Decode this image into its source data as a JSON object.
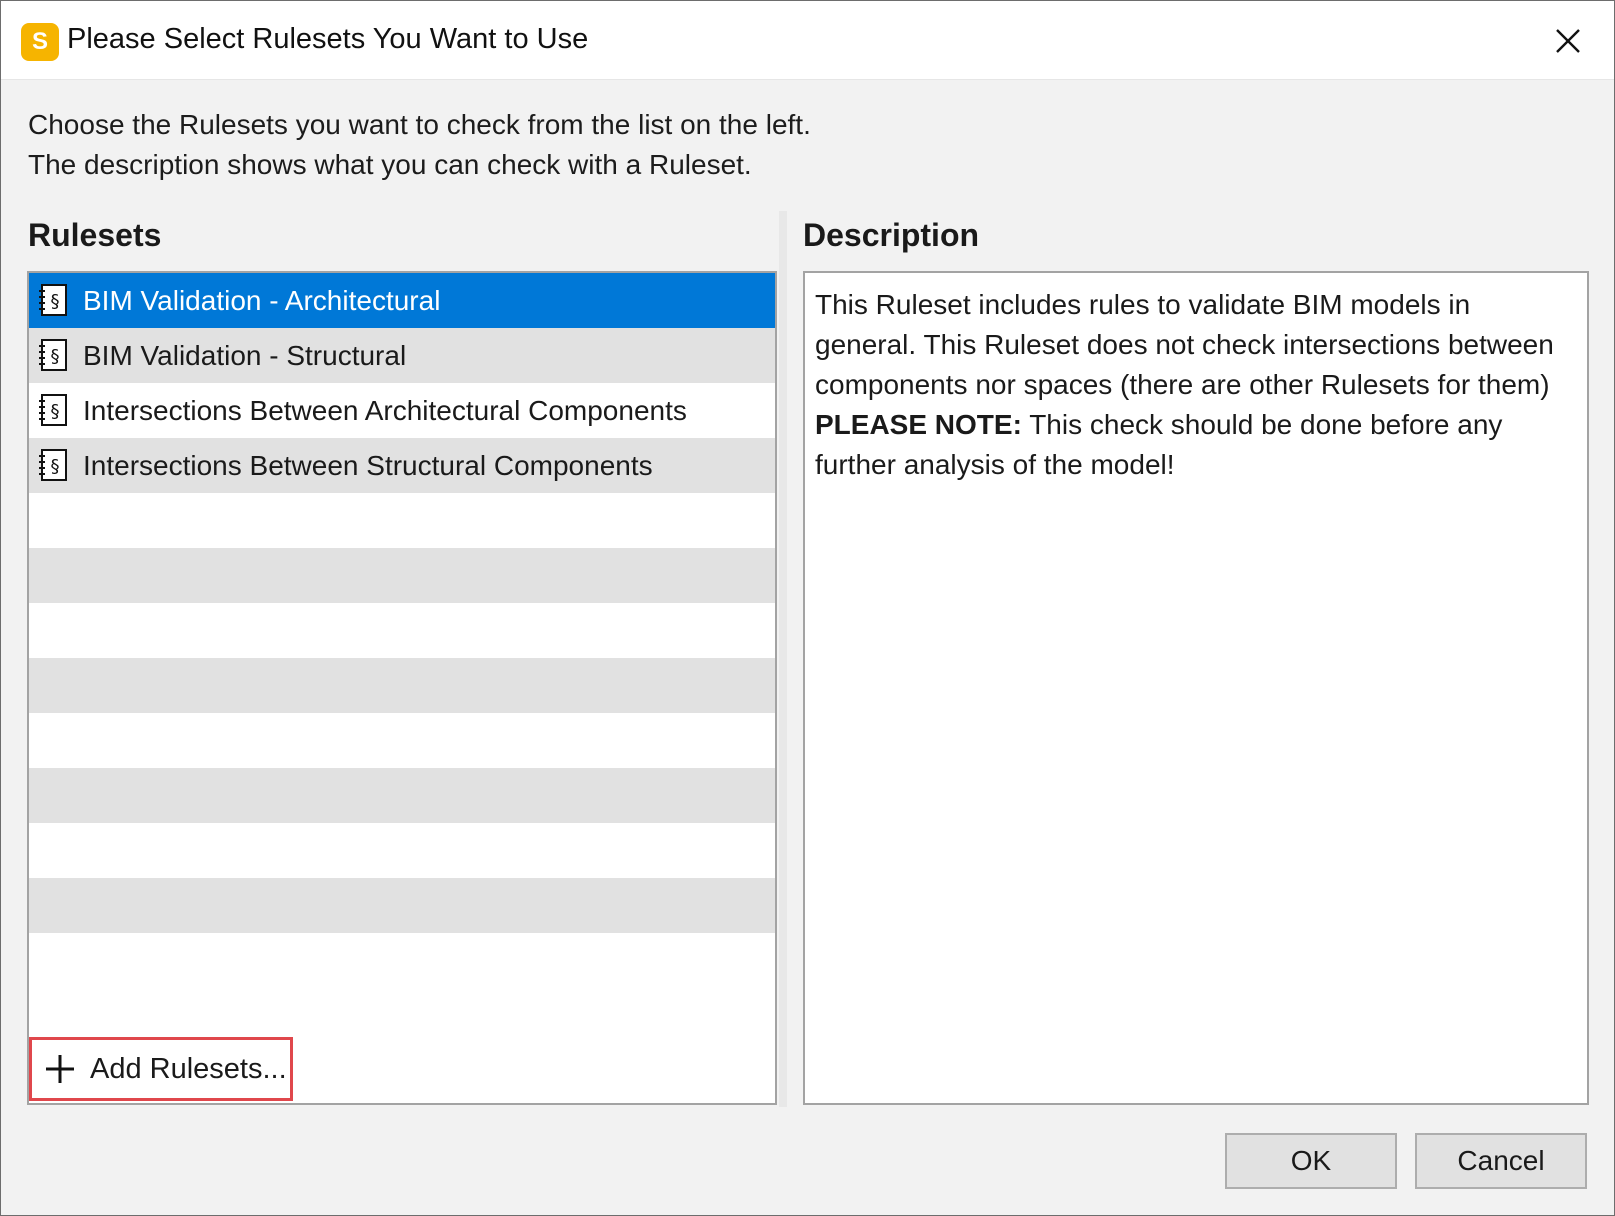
{
  "window": {
    "title": "Please Select Rulesets You Want to Use",
    "app_icon_letter": "S",
    "brand_color": "#f6b400",
    "close_icon": "close-icon"
  },
  "intro": {
    "line1": "Choose the Rulesets you want to check from the list on the left.",
    "line2": "The description shows what you can check with a Ruleset."
  },
  "rulesets": {
    "heading": "Rulesets",
    "selected_color": "#0078d7",
    "items": [
      {
        "label": "BIM Validation - Architectural",
        "icon": "ruleset-icon",
        "selected": true
      },
      {
        "label": "BIM Validation - Structural",
        "icon": "ruleset-icon",
        "selected": false
      },
      {
        "label": "Intersections Between Architectural Components",
        "icon": "ruleset-icon",
        "selected": false
      },
      {
        "label": "Intersections Between Structural Components",
        "icon": "ruleset-icon",
        "selected": false
      }
    ],
    "add_label": "Add Rulesets...",
    "add_icon": "plus-icon"
  },
  "description": {
    "heading": "Description",
    "text": "This Ruleset includes rules to validate BIM models in general. This Ruleset does not check intersections between components nor spaces (there are other Rulesets for them)",
    "note_label": "PLEASE NOTE:",
    "note_text": " This check should be done before any further analysis of the model!"
  },
  "buttons": {
    "ok": "OK",
    "cancel": "Cancel"
  }
}
